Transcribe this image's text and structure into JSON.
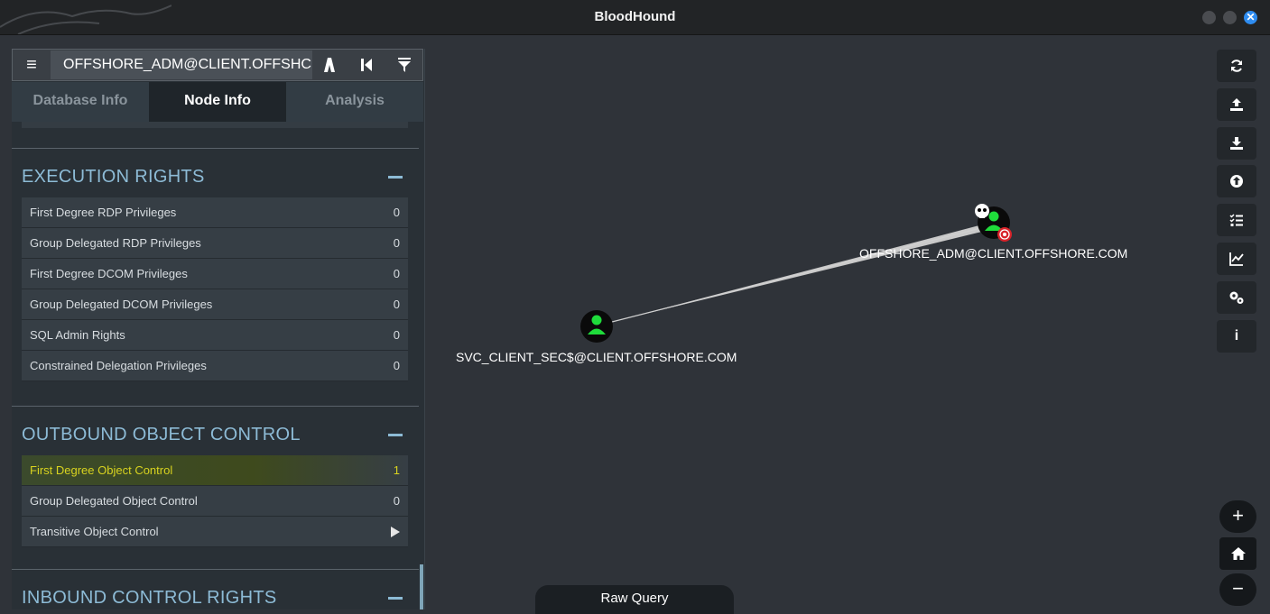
{
  "window": {
    "title": "BloodHound"
  },
  "search": {
    "value": "OFFSHORE_ADM@CLIENT.OFFSHC"
  },
  "tabs": [
    {
      "label": "Database Info"
    },
    {
      "label": "Node Info"
    },
    {
      "label": "Analysis"
    }
  ],
  "sections": {
    "execution": {
      "title": "EXECUTION RIGHTS",
      "rows": [
        {
          "label": "First Degree RDP Privileges",
          "value": "0"
        },
        {
          "label": "Group Delegated RDP Privileges",
          "value": "0"
        },
        {
          "label": "First Degree DCOM Privileges",
          "value": "0"
        },
        {
          "label": "Group Delegated DCOM Privileges",
          "value": "0"
        },
        {
          "label": "SQL Admin Rights",
          "value": "0"
        },
        {
          "label": "Constrained Delegation Privileges",
          "value": "0"
        }
      ]
    },
    "outbound": {
      "title": "OUTBOUND OBJECT CONTROL",
      "rows": [
        {
          "label": "First Degree Object Control",
          "value": "1"
        },
        {
          "label": "Group Delegated Object Control",
          "value": "0"
        },
        {
          "label": "Transitive Object Control",
          "value": ""
        }
      ]
    },
    "inbound": {
      "title": "INBOUND CONTROL RIGHTS"
    }
  },
  "graph": {
    "nodes": [
      {
        "label": "OFFSHORE_ADM@CLIENT.OFFSHORE.COM",
        "type": "user",
        "owned": true,
        "target": true
      },
      {
        "label": "SVC_CLIENT_SEC$@CLIENT.OFFSHORE.COM",
        "type": "user"
      }
    ]
  },
  "toolbar": {
    "icons": [
      "refresh-icon",
      "upload-icon",
      "download-icon",
      "import-icon",
      "queries-icon",
      "chart-icon",
      "settings-icon",
      "info-icon"
    ],
    "info_label": "i"
  },
  "zoom": {
    "in": "+",
    "out": "−"
  },
  "raw_query": {
    "label": "Raw Query"
  },
  "colors": {
    "accent": "#8dbbd6",
    "node": "#1fdc3b",
    "highlight": "#d9d31f",
    "target": "#d8232a"
  }
}
